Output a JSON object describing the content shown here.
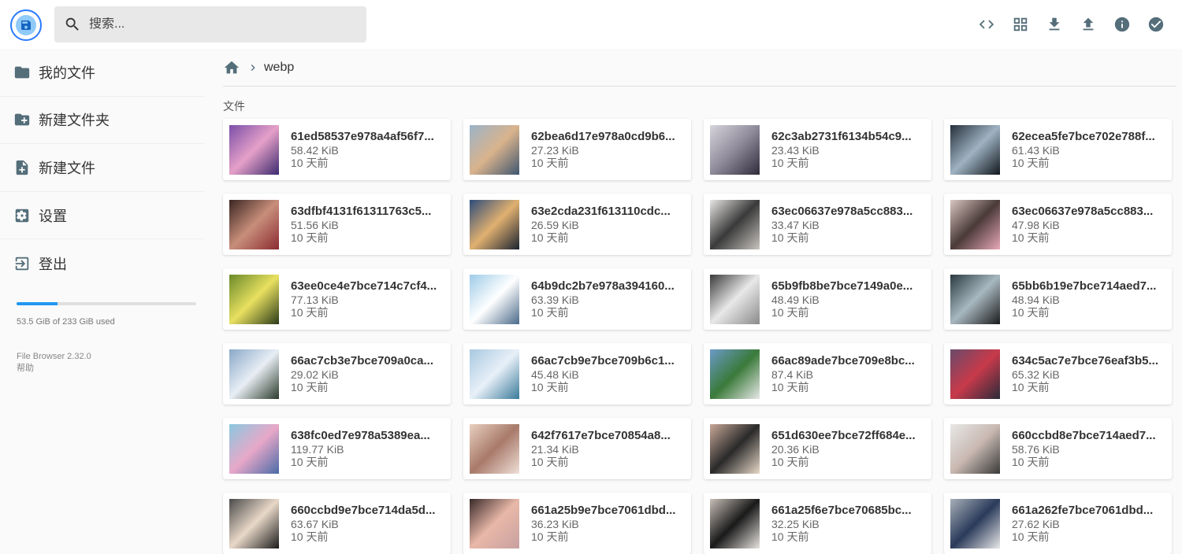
{
  "search": {
    "placeholder": "搜索..."
  },
  "toolbar": {
    "buttons": [
      {
        "icon": "code-icon"
      },
      {
        "icon": "grid-view-icon"
      },
      {
        "icon": "download-icon"
      },
      {
        "icon": "upload-icon"
      },
      {
        "icon": "info-icon"
      },
      {
        "icon": "check-circle-icon"
      }
    ]
  },
  "sidebar": {
    "items": [
      {
        "label": "我的文件",
        "icon": "folder-icon"
      },
      {
        "label": "新建文件夹",
        "icon": "new-folder-icon"
      },
      {
        "label": "新建文件",
        "icon": "new-file-icon"
      },
      {
        "label": "设置",
        "icon": "settings-icon"
      },
      {
        "label": "登出",
        "icon": "logout-icon"
      }
    ],
    "usage": {
      "text": "53.5 GiB of 233 GiB used",
      "fraction": 0.23
    },
    "version": "File Browser 2.32.0",
    "help": "帮助"
  },
  "breadcrumb": {
    "home_icon": "home-icon",
    "current": "webp"
  },
  "section_title": "文件",
  "files": [
    {
      "name": "61ed58537e978a4af56f7...",
      "size": "58.42 KiB",
      "date": "10 天前",
      "colors": [
        "#7b4fa8",
        "#e5a0c8",
        "#3b2a6e"
      ]
    },
    {
      "name": "62bea6d17e978a0cd9b6...",
      "size": "27.23 KiB",
      "date": "10 天前",
      "colors": [
        "#9bb3c8",
        "#d9b38c",
        "#3f5670"
      ]
    },
    {
      "name": "62c3ab2731f6134b54c9...",
      "size": "23.43 KiB",
      "date": "10 天前",
      "colors": [
        "#d8d4dc",
        "#8e8a9a",
        "#2f2b3a"
      ]
    },
    {
      "name": "62ecea5fe7bce702e788f...",
      "size": "61.43 KiB",
      "date": "10 天前",
      "colors": [
        "#25303a",
        "#9fb2c2",
        "#10161c"
      ]
    },
    {
      "name": "63dfbf4131f61311763c5...",
      "size": "51.56 KiB",
      "date": "10 天前",
      "colors": [
        "#3a2622",
        "#c88e7a",
        "#8a2a30"
      ]
    },
    {
      "name": "63e2cda231f613110cdc...",
      "size": "26.59 KiB",
      "date": "10 天前",
      "colors": [
        "#2d4c7a",
        "#e0b070",
        "#1a2230"
      ]
    },
    {
      "name": "63ec06637e978a5cc883...",
      "size": "33.47 KiB",
      "date": "10 天前",
      "colors": [
        "#e8e6e4",
        "#3a3a3a",
        "#c8c4c0"
      ]
    },
    {
      "name": "63ec06637e978a5cc883...",
      "size": "47.98 KiB",
      "date": "10 天前",
      "colors": [
        "#d8c6c0",
        "#4a3a38",
        "#e8a8b8"
      ]
    },
    {
      "name": "63ee0ce4e7bce714c7cf4...",
      "size": "77.13 KiB",
      "date": "10 天前",
      "colors": [
        "#6a8a2a",
        "#e8e060",
        "#2a3a18"
      ]
    },
    {
      "name": "64b9dc2b7e978a394160...",
      "size": "63.39 KiB",
      "date": "10 天前",
      "colors": [
        "#9ecbe8",
        "#ffffff",
        "#4a6a8a"
      ]
    },
    {
      "name": "65b9fb8be7bce7149a0e...",
      "size": "48.49 KiB",
      "date": "10 天前",
      "colors": [
        "#3a3a3a",
        "#e8e8e8",
        "#8a8a8a"
      ]
    },
    {
      "name": "65bb6b19e7bce714aed7...",
      "size": "48.94 KiB",
      "date": "10 天前",
      "colors": [
        "#2a3a40",
        "#a8b8c0",
        "#1a1a1a"
      ]
    },
    {
      "name": "66ac7cb3e7bce709a0ca...",
      "size": "29.02 KiB",
      "date": "10 天前",
      "colors": [
        "#8aa8c8",
        "#e8eef4",
        "#2a3a2a"
      ]
    },
    {
      "name": "66ac7cb9e7bce709b6c1...",
      "size": "45.48 KiB",
      "date": "10 天前",
      "colors": [
        "#a8c8e0",
        "#e8f0f8",
        "#3a7a9a"
      ]
    },
    {
      "name": "66ac89ade7bce709e8bc...",
      "size": "87.4 KiB",
      "date": "10 天前",
      "colors": [
        "#6a9ac8",
        "#3a7a3a",
        "#e8e8e8"
      ]
    },
    {
      "name": "634c5ac7e7bce76eaf3b5...",
      "size": "65.32 KiB",
      "date": "10 天前",
      "colors": [
        "#6a4a6a",
        "#c83a4a",
        "#2a2a3a"
      ]
    },
    {
      "name": "638fc0ed7e978a5389ea...",
      "size": "119.77 KiB",
      "date": "10 天前",
      "colors": [
        "#8ac8e0",
        "#e8a8c8",
        "#4a6aa8"
      ]
    },
    {
      "name": "642f7617e7bce70854a8...",
      "size": "21.34 KiB",
      "date": "10 天前",
      "colors": [
        "#e8d0c0",
        "#a87a6a",
        "#f0e0d8"
      ]
    },
    {
      "name": "651d630ee7bce72ff684e...",
      "size": "20.36 KiB",
      "date": "10 天前",
      "colors": [
        "#c8a898",
        "#2a2a2a",
        "#e8d8c8"
      ]
    },
    {
      "name": "660ccbd8e7bce714aed7...",
      "size": "58.76 KiB",
      "date": "10 天前",
      "colors": [
        "#e8e8e8",
        "#c8b8b0",
        "#3a3a3a"
      ]
    },
    {
      "name": "660ccbd9e7bce714da5d...",
      "size": "63.67 KiB",
      "date": "10 天前",
      "colors": [
        "#4a4a4a",
        "#e8d8c8",
        "#1a1a1a"
      ]
    },
    {
      "name": "661a25b9e7bce7061dbd...",
      "size": "36.23 KiB",
      "date": "10 天前",
      "colors": [
        "#3a2a2a",
        "#e8b8a8",
        "#c8a0a0"
      ]
    },
    {
      "name": "661a25f6e7bce70685bc...",
      "size": "32.25 KiB",
      "date": "10 天前",
      "colors": [
        "#c8c0b8",
        "#1a1a1a",
        "#e8e4e0"
      ]
    },
    {
      "name": "661a262fe7bce7061dbd...",
      "size": "27.62 KiB",
      "date": "10 天前",
      "colors": [
        "#a8b0b8",
        "#2a3a5a",
        "#e8e8e8"
      ]
    }
  ]
}
